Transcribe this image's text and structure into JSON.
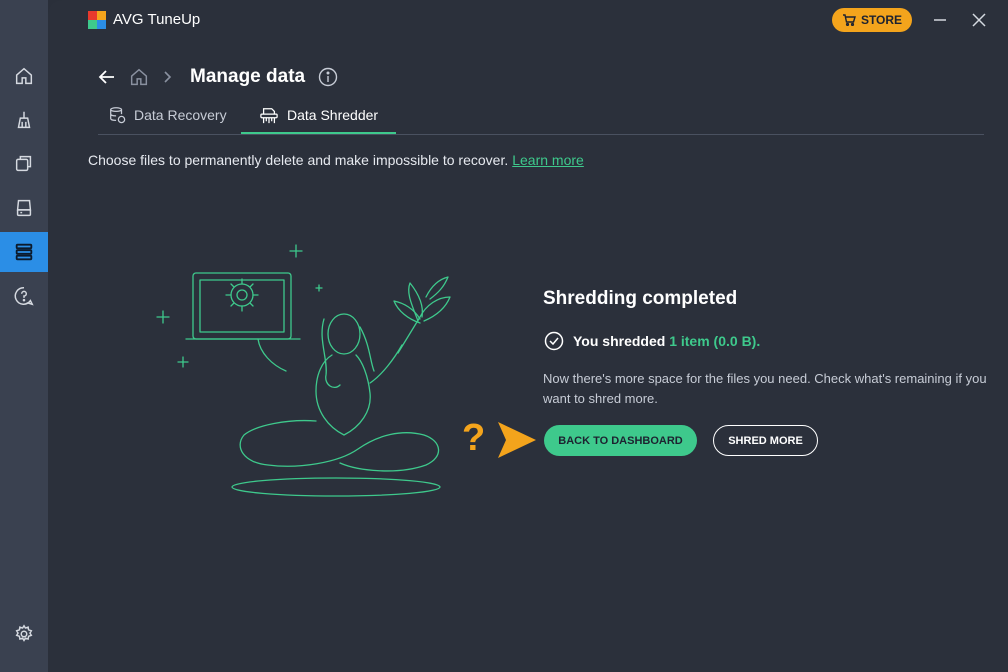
{
  "app": {
    "title": "AVG TuneUp",
    "store_label": "STORE"
  },
  "sidebar": {
    "items": [
      {
        "icon": "home-icon"
      },
      {
        "icon": "broom-icon"
      },
      {
        "icon": "apps-icon"
      },
      {
        "icon": "drive-icon"
      },
      {
        "icon": "data-icon",
        "active": true
      },
      {
        "icon": "help-icon"
      }
    ],
    "settings_icon": "gear-icon"
  },
  "header": {
    "title": "Manage data"
  },
  "tabs": [
    {
      "label": "Data Recovery",
      "icon": "database-recover-icon"
    },
    {
      "label": "Data Shredder",
      "icon": "shredder-icon",
      "active": true
    }
  ],
  "description": {
    "text": "Choose files to permanently delete and make impossible to recover.",
    "link": "Learn more"
  },
  "result": {
    "title": "Shredding completed",
    "line_prefix": "You shredded",
    "line_highlight": "1 item (0.0 B).",
    "desc": "Now there's more space for the files you need. Check what's remaining if you want to shred more."
  },
  "buttons": {
    "primary": "BACK TO DASHBOARD",
    "secondary": "SHRED MORE"
  },
  "annotation": {
    "question": "?"
  },
  "colors": {
    "accent": "#3ec98c",
    "store": "#f4a41c",
    "sidebar_active": "#2b8ee6",
    "background": "#2b303b"
  }
}
